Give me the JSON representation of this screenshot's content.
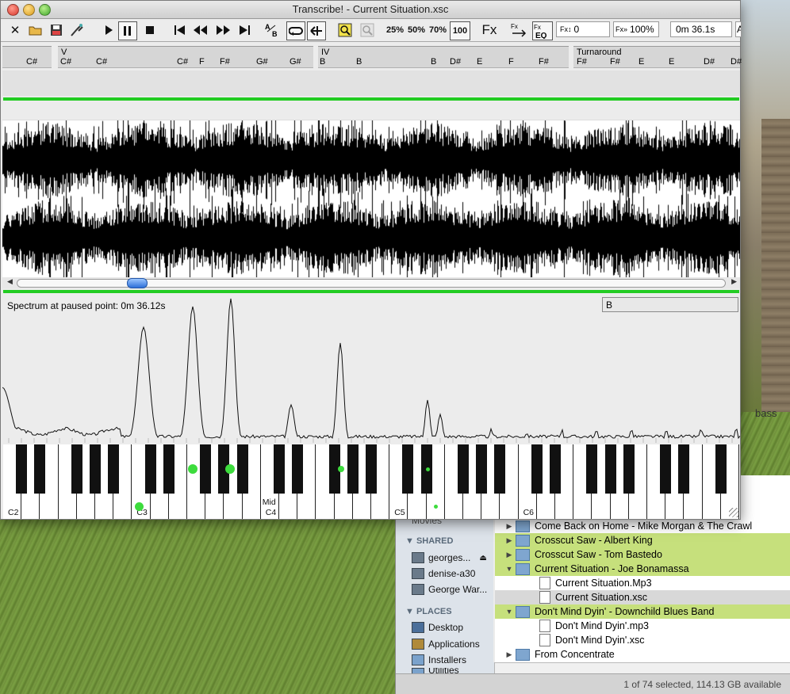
{
  "window": {
    "title": "Transcribe! - Current Situation.xsc"
  },
  "toolbar": {
    "speed_25": "25%",
    "speed_50": "50%",
    "speed_70": "70%",
    "speed_100": "100",
    "fx_label": "Fx",
    "pitch_value": "0",
    "tempo_value": "100%",
    "time_value": "0m 36.1s",
    "overflow_label": "A"
  },
  "sections": [
    {
      "name": "",
      "chords": [
        "C#"
      ]
    },
    {
      "name": "V",
      "chords": [
        "C#",
        "C#",
        "C#",
        "F",
        "F#",
        "G#",
        "G#"
      ]
    },
    {
      "name": "IV",
      "chords": [
        "B",
        "B",
        "B",
        "D#",
        "E",
        "F",
        "F#"
      ]
    },
    {
      "name": "Turnaround",
      "chords": [
        "F#",
        "F#",
        "E",
        "E",
        "D#",
        "D#"
      ]
    }
  ],
  "spectrum": {
    "label": "Spectrum at paused point: 0m 36.12s",
    "note": "B"
  },
  "piano": {
    "octave_labels": [
      "C2",
      "C3",
      "C4",
      "C5",
      "C6"
    ],
    "mid_label": "Mid",
    "active_color": "#3ddc3d"
  },
  "finder": {
    "shared_header": "SHARED",
    "shared": [
      "georges...",
      "denise-a30",
      "George War..."
    ],
    "places_header": "PLACES",
    "places": [
      "Desktop",
      "Applications",
      "Installers",
      "Utilities"
    ],
    "partial_top": "Movies",
    "rows": [
      {
        "label": "Come Back on Home - Mike Morgan & The Crawl",
        "kind": "folder",
        "state": "",
        "open": false,
        "indent": 0
      },
      {
        "label": "Crosscut Saw - Albert King",
        "kind": "folder",
        "state": "hl",
        "open": false,
        "indent": 0
      },
      {
        "label": "Crosscut Saw - Tom Bastedo",
        "kind": "folder",
        "state": "hl",
        "open": false,
        "indent": 0
      },
      {
        "label": "Current Situation - Joe Bonamassa",
        "kind": "folder",
        "state": "hl",
        "open": true,
        "indent": 0
      },
      {
        "label": "Current Situation.Mp3",
        "kind": "file",
        "state": "",
        "open": false,
        "indent": 1
      },
      {
        "label": "Current Situation.xsc",
        "kind": "file",
        "state": "sel",
        "open": false,
        "indent": 1
      },
      {
        "label": "Don't Mind Dyin' - Downchild Blues Band",
        "kind": "folder",
        "state": "hl",
        "open": true,
        "indent": 0
      },
      {
        "label": "Don't Mind Dyin'.mp3",
        "kind": "file",
        "state": "",
        "open": false,
        "indent": 1
      },
      {
        "label": "Don't Mind Dyin'.xsc",
        "kind": "file",
        "state": "",
        "open": false,
        "indent": 1
      },
      {
        "label": "From Concentrate",
        "kind": "folder",
        "state": "",
        "open": false,
        "indent": 0
      }
    ],
    "status": "1 of 74 selected, 114.13 GB available"
  },
  "desktop": {
    "partial_text": "bass"
  }
}
